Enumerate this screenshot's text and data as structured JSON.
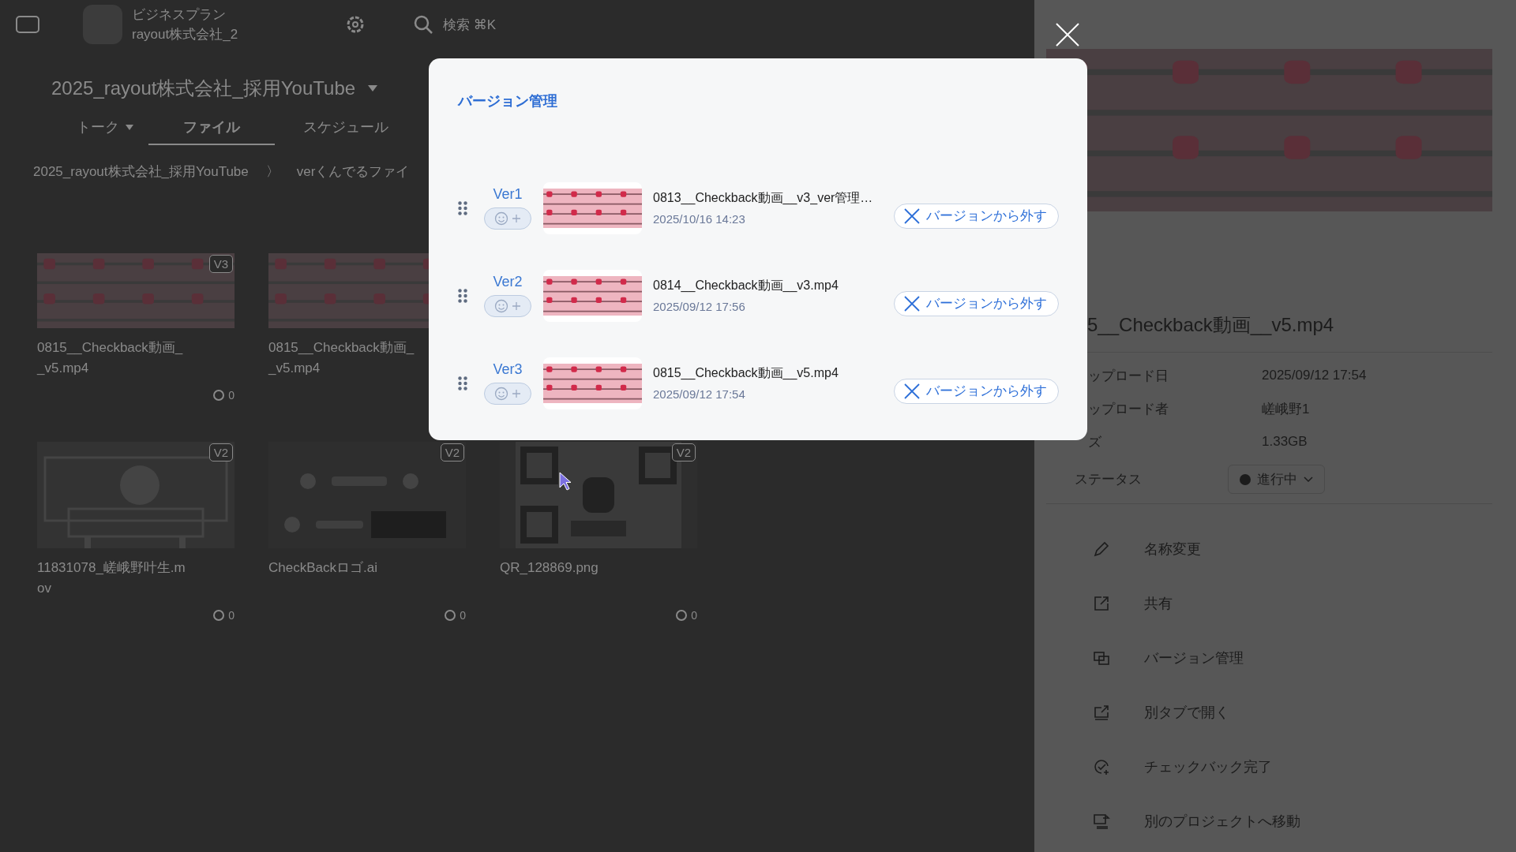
{
  "app": {
    "plan": "ビジネスプラン",
    "workspace": "rayout株式会社_2",
    "search_label": "検索 ⌘K",
    "project_title": "2025_rayout株式会社_採用YouTube",
    "tabs": [
      {
        "label": "トーク",
        "selected": false,
        "dropdown": true
      },
      {
        "label": "ファイル",
        "selected": true,
        "dropdown": false
      },
      {
        "label": "スケジュール",
        "selected": false,
        "dropdown": false
      }
    ],
    "breadcrumb": [
      "2025_rayout株式会社_採用YouTube",
      "verくんでるファイ"
    ],
    "breadcrumb_separator": "〉",
    "file_rows": [
      [
        {
          "name": "0815__Checkback動画__v5.mp4",
          "version": "V3",
          "comments": "0"
        },
        {
          "name": "0815__Checkback動画__v5.mp4"
        }
      ],
      [
        {
          "name": "11831078_嵯峨野叶生.mov",
          "version": "V2",
          "comments": "0"
        },
        {
          "name": "CheckBackロゴ.ai",
          "version": "V2",
          "comments": "0"
        },
        {
          "name": "QR_128869.png",
          "version": "V2",
          "comments": "0"
        }
      ]
    ]
  },
  "detail_panel": {
    "file_name": "5__Checkback動画__v5.mp4",
    "details": [
      {
        "label": "ップロード日",
        "value": "2025/09/12 17:54"
      },
      {
        "label": "ップロード者",
        "value": "嵯峨野1"
      },
      {
        "label": "ズ",
        "value": "1.33GB"
      }
    ],
    "status": {
      "label": "ステータス",
      "value": "進行中"
    },
    "actions": [
      {
        "label": "名称変更"
      },
      {
        "label": "共有"
      },
      {
        "label": "バージョン管理"
      },
      {
        "label": "別タブで開く"
      },
      {
        "label": "チェックバック完了"
      },
      {
        "label": "別のプロジェクトへ移動"
      }
    ]
  },
  "modal": {
    "title": "バージョン管理",
    "versions": [
      {
        "label": "Ver1",
        "name": "0813__Checkback動画__v3_ver管理…",
        "date": "2025/10/16 14:23",
        "remove": "バージョンから外す"
      },
      {
        "label": "Ver2",
        "name": "0814__Checkback動画__v3.mp4",
        "date": "2025/09/12 17:56",
        "remove": "バージョンから外す"
      },
      {
        "label": "Ver3",
        "name": "0815__Checkback動画__v5.mp4",
        "date": "2025/09/12 17:54",
        "remove": "バージョンから外す"
      }
    ]
  }
}
